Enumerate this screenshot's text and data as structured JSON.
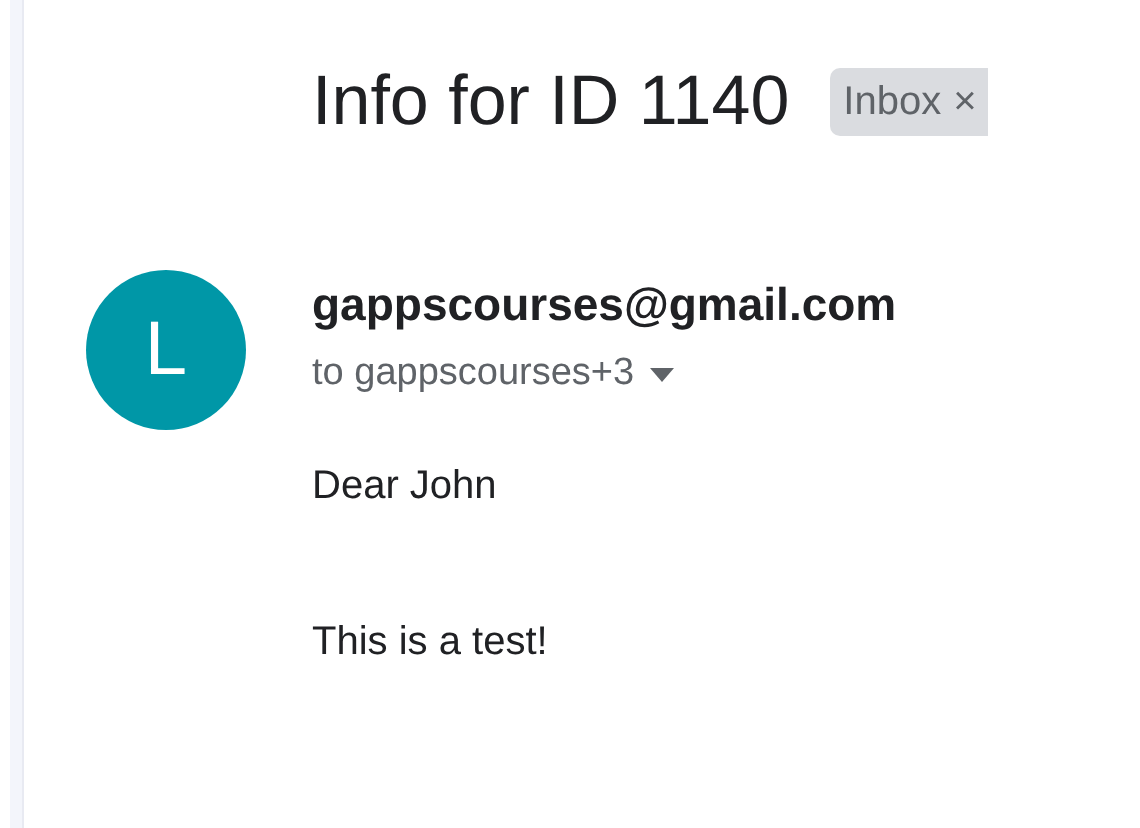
{
  "subject": "Info for ID 1140",
  "label_chip": {
    "label": "Inbox",
    "remove": "×"
  },
  "sender": {
    "avatar_letter": "L",
    "email": "gappscourses@gmail.com",
    "recipients": "to gappscourses+3"
  },
  "body": [
    "Dear John",
    "This is a test!"
  ]
}
